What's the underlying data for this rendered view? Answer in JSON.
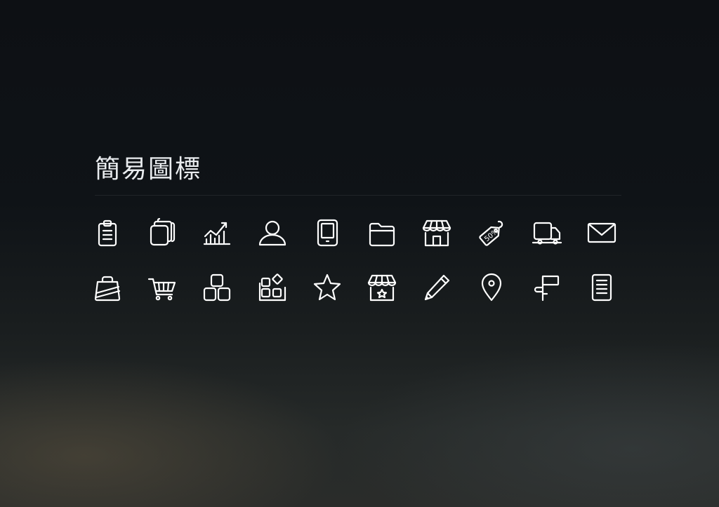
{
  "page": {
    "title": "簡易圖標"
  },
  "colors": {
    "icon_stroke": "#ffffff",
    "title_text": "#e9ecef",
    "background_top": "#0d1014",
    "background_bottom": "#2a2c2a"
  },
  "icons": {
    "row1": [
      "clipboard-icon",
      "cards-stack-icon",
      "chart-icon",
      "user-icon",
      "tablet-icon",
      "folder-icon",
      "store-icon",
      "discount-tag-icon",
      "delivery-truck-icon",
      "mail-icon"
    ],
    "row2": [
      "shopping-bag-icon",
      "shopping-cart-icon",
      "blocks-icon",
      "apps-icon",
      "star-icon",
      "featured-store-icon",
      "pencil-icon",
      "location-pin-icon",
      "signpost-icon",
      "document-icon"
    ]
  },
  "tag": {
    "text": "50%"
  }
}
